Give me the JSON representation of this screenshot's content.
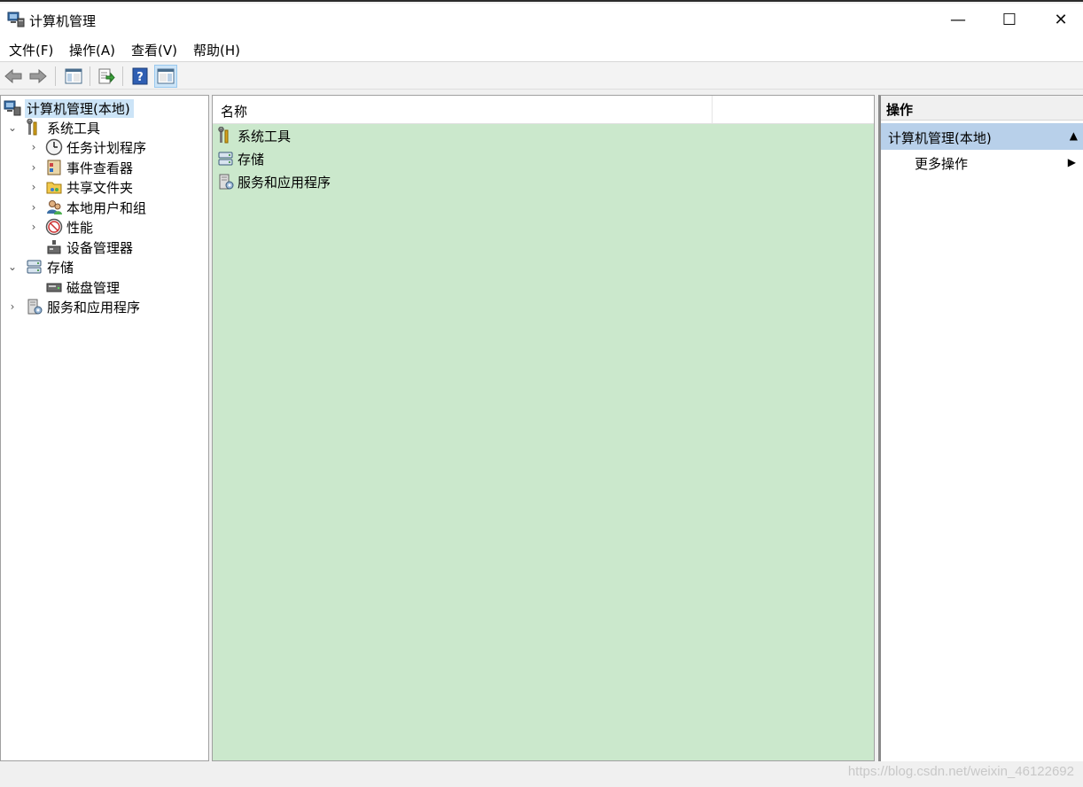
{
  "window": {
    "title": "计算机管理",
    "minimize_glyph": "—",
    "maximize_glyph": "☐",
    "close_glyph": "✕"
  },
  "menu": [
    "文件(F)",
    "操作(A)",
    "查看(V)",
    "帮助(H)"
  ],
  "toolbar": {
    "icons": [
      "back-icon",
      "forward-icon",
      "show-hide-console-tree-icon",
      "export-list-icon",
      "help-icon",
      "show-hide-action-pane-icon"
    ]
  },
  "tree": {
    "root": "计算机管理(本地)",
    "system_tools": "系统工具",
    "task_scheduler": "任务计划程序",
    "event_viewer": "事件查看器",
    "shared_folders": "共享文件夹",
    "local_users": "本地用户和组",
    "performance": "性能",
    "device_manager": "设备管理器",
    "storage": "存储",
    "disk_management": "磁盘管理",
    "services_apps": "服务和应用程序",
    "expanded_glyph": "⌄",
    "collapsed_glyph": "›"
  },
  "center": {
    "column_name": "名称",
    "items": [
      "系统工具",
      "存储",
      "服务和应用程序"
    ],
    "background": "#cbe8cc"
  },
  "actions": {
    "header": "操作",
    "group": "计算机管理(本地)",
    "group_toggle": "▲",
    "item": "更多操作",
    "item_arrow": "▶"
  },
  "watermark": "https://blog.csdn.net/weixin_46122692",
  "colors": {
    "selection": "#cce4f7",
    "action_group": "#b8d0ea"
  }
}
